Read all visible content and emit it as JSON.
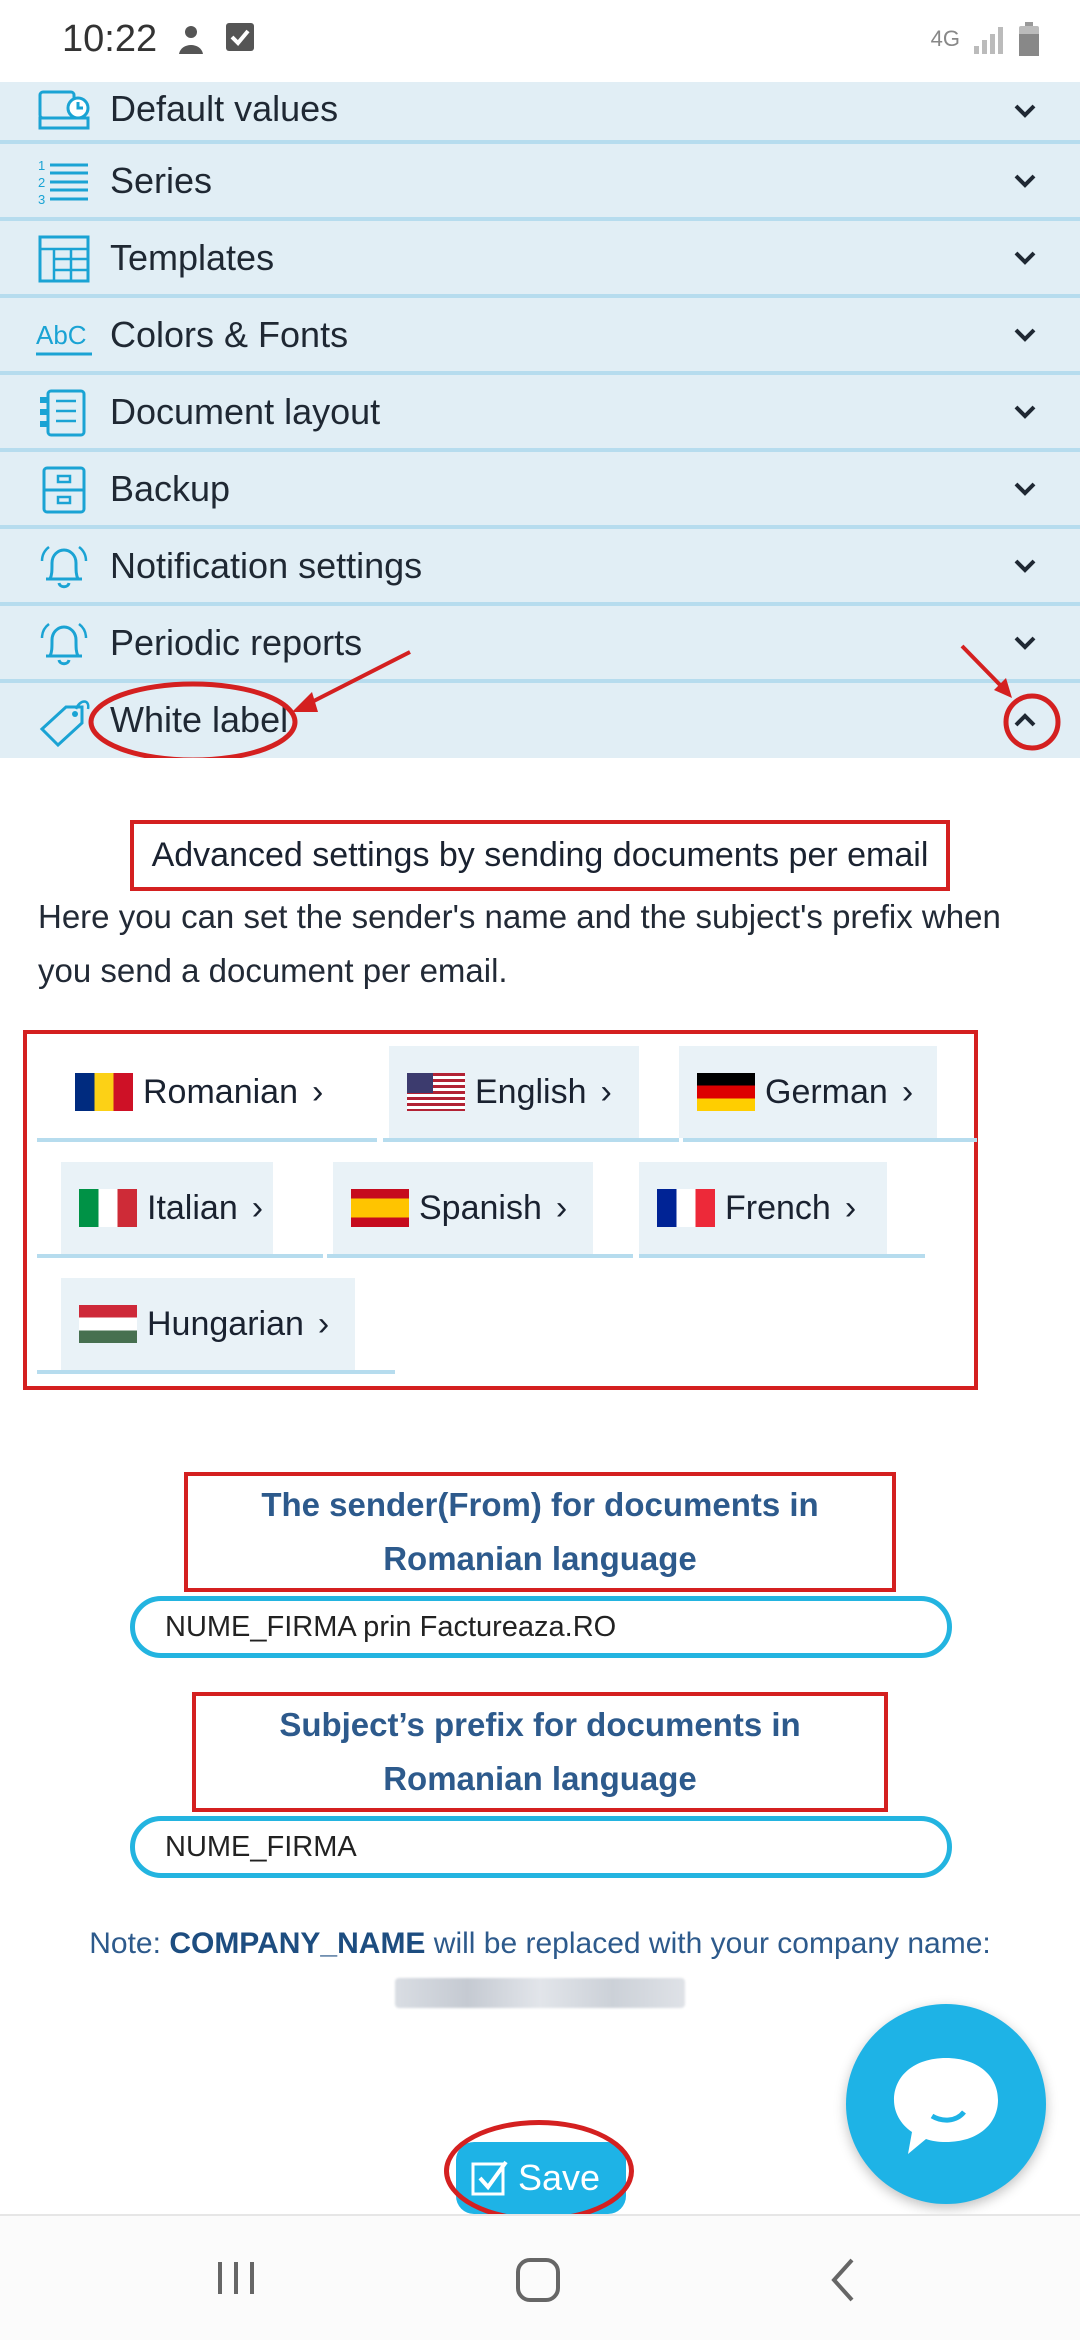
{
  "status": {
    "time": "10:22",
    "network": "4G"
  },
  "accordion": {
    "items": [
      {
        "label": "Default values",
        "icon": "calendar-clock-icon"
      },
      {
        "label": "Series",
        "icon": "numbered-list-icon"
      },
      {
        "label": "Templates",
        "icon": "template-grid-icon"
      },
      {
        "label": "Colors & Fonts",
        "icon": "abc-font-icon"
      },
      {
        "label": "Document layout",
        "icon": "document-layout-icon"
      },
      {
        "label": "Backup",
        "icon": "drawer-icon"
      },
      {
        "label": "Notification settings",
        "icon": "bell-icon"
      },
      {
        "label": "Periodic reports",
        "icon": "bell-icon"
      },
      {
        "label": "White label",
        "icon": "price-tag-icon",
        "open": true
      }
    ]
  },
  "panel": {
    "title": "Advanced settings by sending documents per email",
    "description": "Here you can set the sender's name and the subject's prefix when you send a document per email.",
    "languages": [
      "Romanian",
      "English",
      "German",
      "Italian",
      "Spanish",
      "French",
      "Hungarian"
    ],
    "language_arrow": "›",
    "sender_label": "The sender(From) for documents in Romanian language",
    "sender_value": "NUME_FIRMA prin Factureaza.RO",
    "subject_label": "Subject’s prefix for documents in Romanian language",
    "subject_value": "NUME_FIRMA",
    "note_prefix": "Note:",
    "note_keyword": "COMPANY_NAME",
    "note_suffix": "will be replaced with your company name:",
    "save_label": "Save"
  },
  "colors": {
    "accent": "#1eb3e6",
    "annotation": "#d42020",
    "row_bg": "#e1eef5",
    "label_blue": "#2d5a8c"
  }
}
